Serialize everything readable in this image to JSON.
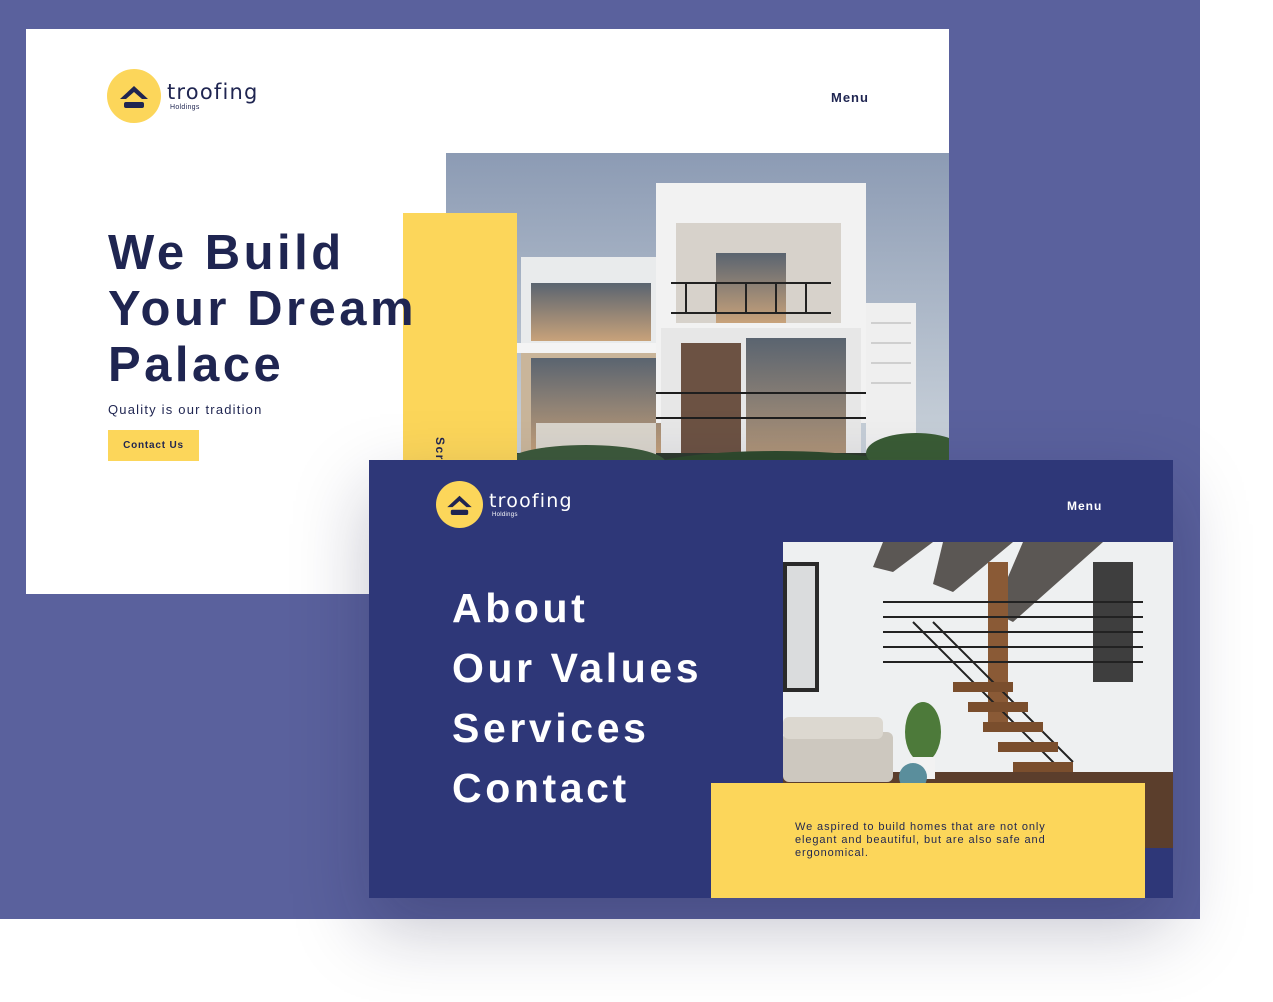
{
  "brand": {
    "name": "troofing",
    "sub": "Holdings"
  },
  "home": {
    "menu_label": "Menu",
    "headline": [
      "We Build",
      "Your Dream",
      "Palace"
    ],
    "tagline": "Quality is our tradition",
    "cta_label": "Contact Us",
    "scroll_label": "Scroll"
  },
  "menu_page": {
    "menu_label": "Menu",
    "nav": [
      "About",
      "Our Values",
      "Services",
      "Contact"
    ],
    "about_text": "We aspired to build homes that are not only elegant and beautiful, but are also safe and ergonomical."
  },
  "colors": {
    "background": "#5a619d",
    "navy": "#2e3778",
    "text_dark": "#1f2551",
    "accent_yellow": "#fcd65a",
    "white": "#ffffff"
  },
  "icons": {
    "logo": "house-roof-icon"
  }
}
